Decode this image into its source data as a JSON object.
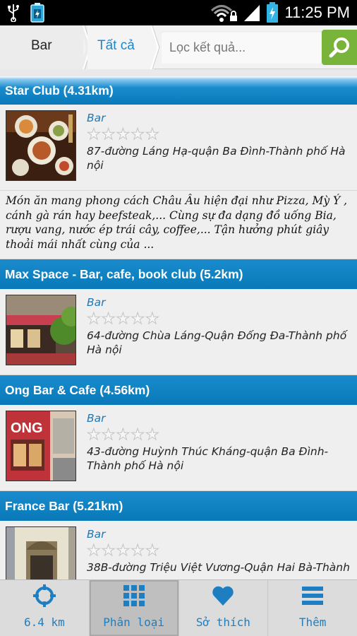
{
  "status_bar": {
    "time": "11:25 PM",
    "icons": [
      "usb-icon",
      "battery-widget-icon",
      "wifi-icon",
      "lock-icon",
      "signal-icon",
      "battery-charging-icon"
    ]
  },
  "topbar": {
    "breadcrumb_root": "Bar",
    "breadcrumb_current": "Tất cả",
    "search_placeholder": "Lọc kết quả...",
    "search_icon": "search-icon",
    "accent": "#78b33a"
  },
  "list": {
    "header_color": "#0878b8",
    "items": [
      {
        "title": "Star Club (4.31km)",
        "category": "Bar",
        "rating": 0,
        "address": "87-đường Láng Hạ-quận Ba Đình-Thành phố Hà nội",
        "description": "Món ăn mang phong cách Châu Âu hiện đại như Pizza, Mỳ Ý , cánh gà rán hay beefsteak,... Cùng sự đa dạng đồ uống Bia, rượu vang, nước ép trái cây, coffee,... Tận hưởng phút giây thoải mái nhất cùng của ..."
      },
      {
        "title": "Max Space - Bar, cafe, book club (5.2km)",
        "category": "Bar",
        "rating": 0,
        "address": "64-đường Chùa Láng-Quận Đống Đa-Thành phố Hà nội"
      },
      {
        "title": "Ong Bar & Cafe (4.56km)",
        "category": "Bar",
        "rating": 0,
        "address": "43-đường Huỳnh Thúc Kháng-quận Ba Đình-Thành phố Hà nội",
        "photo_sign": "ONG"
      },
      {
        "title": "France Bar (5.21km)",
        "category": "Bar",
        "rating": 0,
        "address": "38B-đường Triệu Việt Vương-Quận Hai Bà-Thành"
      }
    ]
  },
  "tabs": [
    {
      "label": "6.4 km",
      "icon": "crosshair-icon",
      "active": false
    },
    {
      "label": "Phân loại",
      "icon": "grid-icon",
      "active": true
    },
    {
      "label": "Sở thích",
      "icon": "heart-icon",
      "active": false
    },
    {
      "label": "Thêm",
      "icon": "menu-icon",
      "active": false
    }
  ]
}
